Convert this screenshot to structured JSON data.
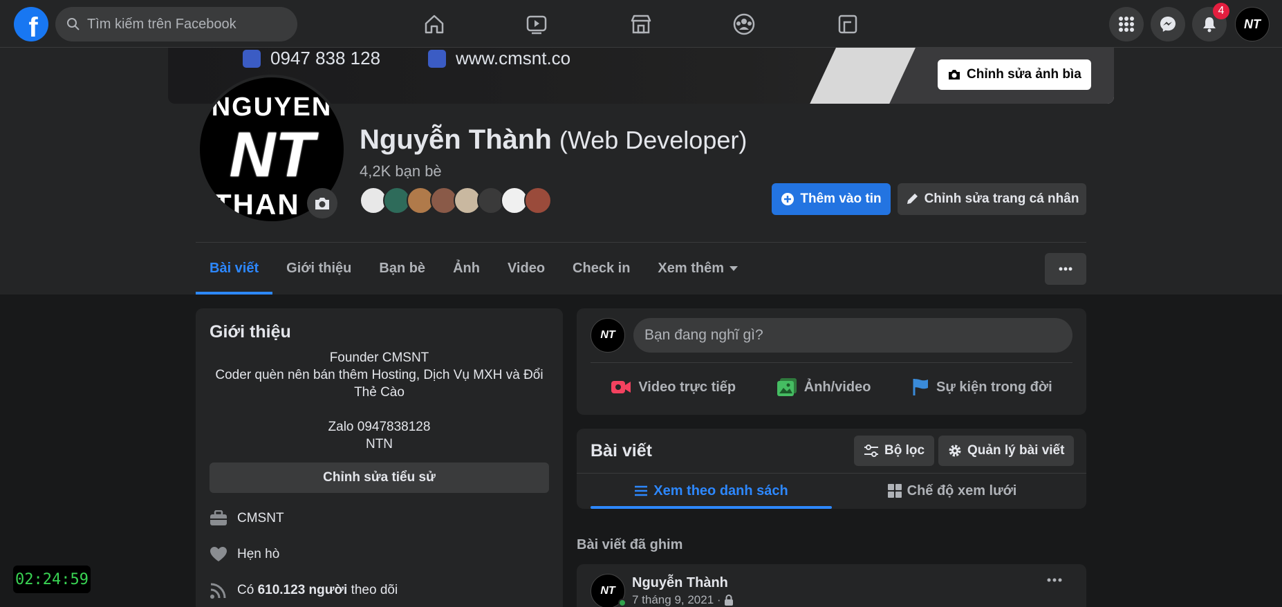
{
  "topnav": {
    "search_placeholder": "Tìm kiếm trên Facebook",
    "notification_count": "4",
    "avatar_text": "NT"
  },
  "cover": {
    "phone": "0947 838 128",
    "website": "www.cmsnt.co",
    "edit_label": "Chỉnh sửa ảnh bìa"
  },
  "profile": {
    "pic_top": "NGUYEN",
    "pic_mid": "NT",
    "pic_bot": "THAN",
    "name": "Nguyễn Thành",
    "name_suffix": "(Web Developer)",
    "friends": "4,2K bạn bè",
    "add_story_label": "Thêm vào tin",
    "edit_profile_label": "Chỉnh sửa trang cá nhân"
  },
  "tabs": [
    "Bài viết",
    "Giới thiệu",
    "Bạn bè",
    "Ảnh",
    "Video",
    "Check in",
    "Xem thêm"
  ],
  "intro": {
    "title": "Giới thiệu",
    "bio": "Founder CMSNT\nCoder quèn nên bán thêm Hosting, Dịch Vụ MXH và Đổi Thẻ Cào\n\nZalo 0947838128\nNTN",
    "edit_bio_label": "Chỉnh sửa tiểu sử",
    "work": "CMSNT",
    "relationship": "Hẹn hò",
    "followers_prefix": "Có",
    "followers_count": "610.123 người",
    "followers_suffix": "theo dõi"
  },
  "composer": {
    "placeholder": "Bạn đang nghĩ gì?",
    "live_label": "Video trực tiếp",
    "photo_label": "Ảnh/video",
    "event_label": "Sự kiện trong đời"
  },
  "posts": {
    "title": "Bài viết",
    "filter_label": "Bộ lọc",
    "manage_label": "Quản lý bài viết",
    "list_view_label": "Xem theo danh sách",
    "grid_view_label": "Chế độ xem lưới",
    "pinned_label": "Bài viết đã ghim",
    "post_author": "Nguyễn Thành",
    "post_date": "7 tháng 9, 2021 ·"
  },
  "clock": "02:24:59",
  "colors": {
    "accent": "#2d88ff",
    "button_blue": "#2374e1",
    "background": "#18191a",
    "surface": "#242526",
    "badge": "#e41e3f"
  }
}
